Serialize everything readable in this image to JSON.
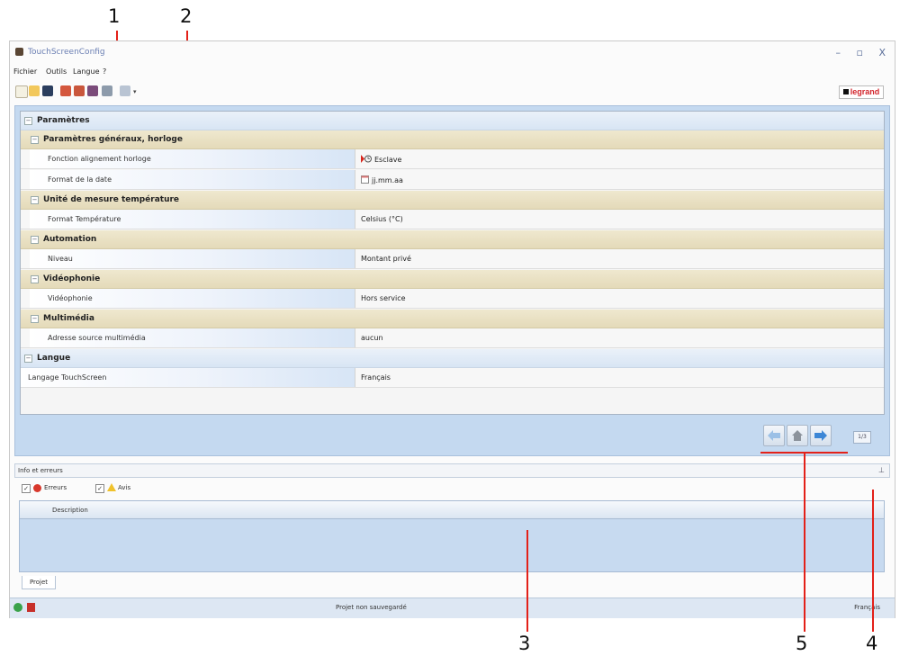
{
  "window": {
    "title": "TouchScreenConfig",
    "controls": {
      "minimize": "–",
      "maximize": "▫",
      "close": "X"
    }
  },
  "menu": [
    "Fichier",
    "Outils",
    "Langue",
    "?"
  ],
  "toolbar": {
    "logo_text": "legrand"
  },
  "properties": [
    {
      "kind": "section",
      "label": "Paramètres"
    },
    {
      "kind": "subsection",
      "label": "Paramètres généraux, horloge"
    },
    {
      "kind": "property",
      "name": "Fonction alignement horloge",
      "value": "Esclave",
      "icon": "clock-slave-icon"
    },
    {
      "kind": "property",
      "name": "Format de la date",
      "value": "jj.mm.aa",
      "icon": "calendar-icon"
    },
    {
      "kind": "subsection",
      "label": "Unité de mesure température"
    },
    {
      "kind": "property",
      "name": "Format Température",
      "value": "Celsius (°C)"
    },
    {
      "kind": "subsection",
      "label": "Automation"
    },
    {
      "kind": "property",
      "name": "Niveau",
      "value": "Montant privé"
    },
    {
      "kind": "subsection",
      "label": "Vidéophonie"
    },
    {
      "kind": "property",
      "name": "Vidéophonie",
      "value": "Hors service"
    },
    {
      "kind": "subsection",
      "label": "Multimédia"
    },
    {
      "kind": "property",
      "name": "Adresse source multimédia",
      "value": "aucun"
    },
    {
      "kind": "section",
      "label": "Langue"
    },
    {
      "kind": "property",
      "name": "Langage TouchScreen",
      "value": "Français",
      "top_level": true
    }
  ],
  "navigation": {
    "page_indicator": "1/3"
  },
  "info_panel": {
    "title": "Info et erreurs",
    "pin_icon": "pin-icon",
    "filters": [
      {
        "label": "Erreurs",
        "checked": true,
        "icon": "error-icon"
      },
      {
        "label": "Avis",
        "checked": true,
        "icon": "warning-icon"
      }
    ],
    "column_header": "Description"
  },
  "tabs": [
    "Projet"
  ],
  "status": {
    "message": "Projet non sauvegardé",
    "language": "Français"
  },
  "callouts": [
    "1",
    "2",
    "3",
    "4",
    "5"
  ],
  "colors": {
    "callout": "#e32119",
    "brand": "#d2232a",
    "panel": "#c4d9f0"
  }
}
